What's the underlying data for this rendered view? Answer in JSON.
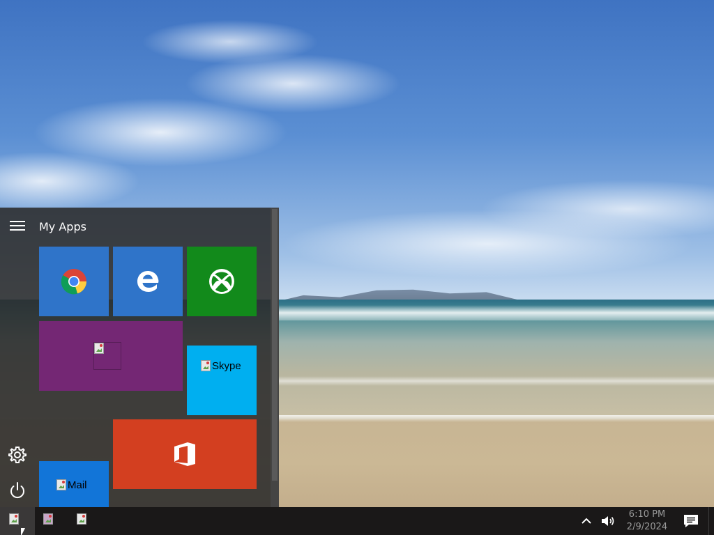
{
  "start_menu": {
    "title": "My Apps",
    "tiles": {
      "chrome": {
        "icon": "chrome-icon",
        "color": "#2f74c9"
      },
      "edge": {
        "icon": "edge-icon",
        "color": "#2f74c9"
      },
      "xbox": {
        "icon": "xbox-icon",
        "color": "#128a1b"
      },
      "photos": {
        "icon": "broken-image-icon",
        "color": "#742774"
      },
      "skype": {
        "alt": "Skype",
        "color": "#00aff0"
      },
      "office": {
        "icon": "office-icon",
        "color": "#d33f20"
      },
      "mail": {
        "alt": "Mail",
        "color": "#1275d8"
      }
    },
    "side_icons": [
      "hamburger-icon",
      "settings-icon",
      "power-icon"
    ]
  },
  "taskbar": {
    "apps": [
      "start-button",
      "photos-app",
      "app-3"
    ],
    "tray": {
      "time": "6:10 PM",
      "date": "2/9/2024"
    }
  }
}
